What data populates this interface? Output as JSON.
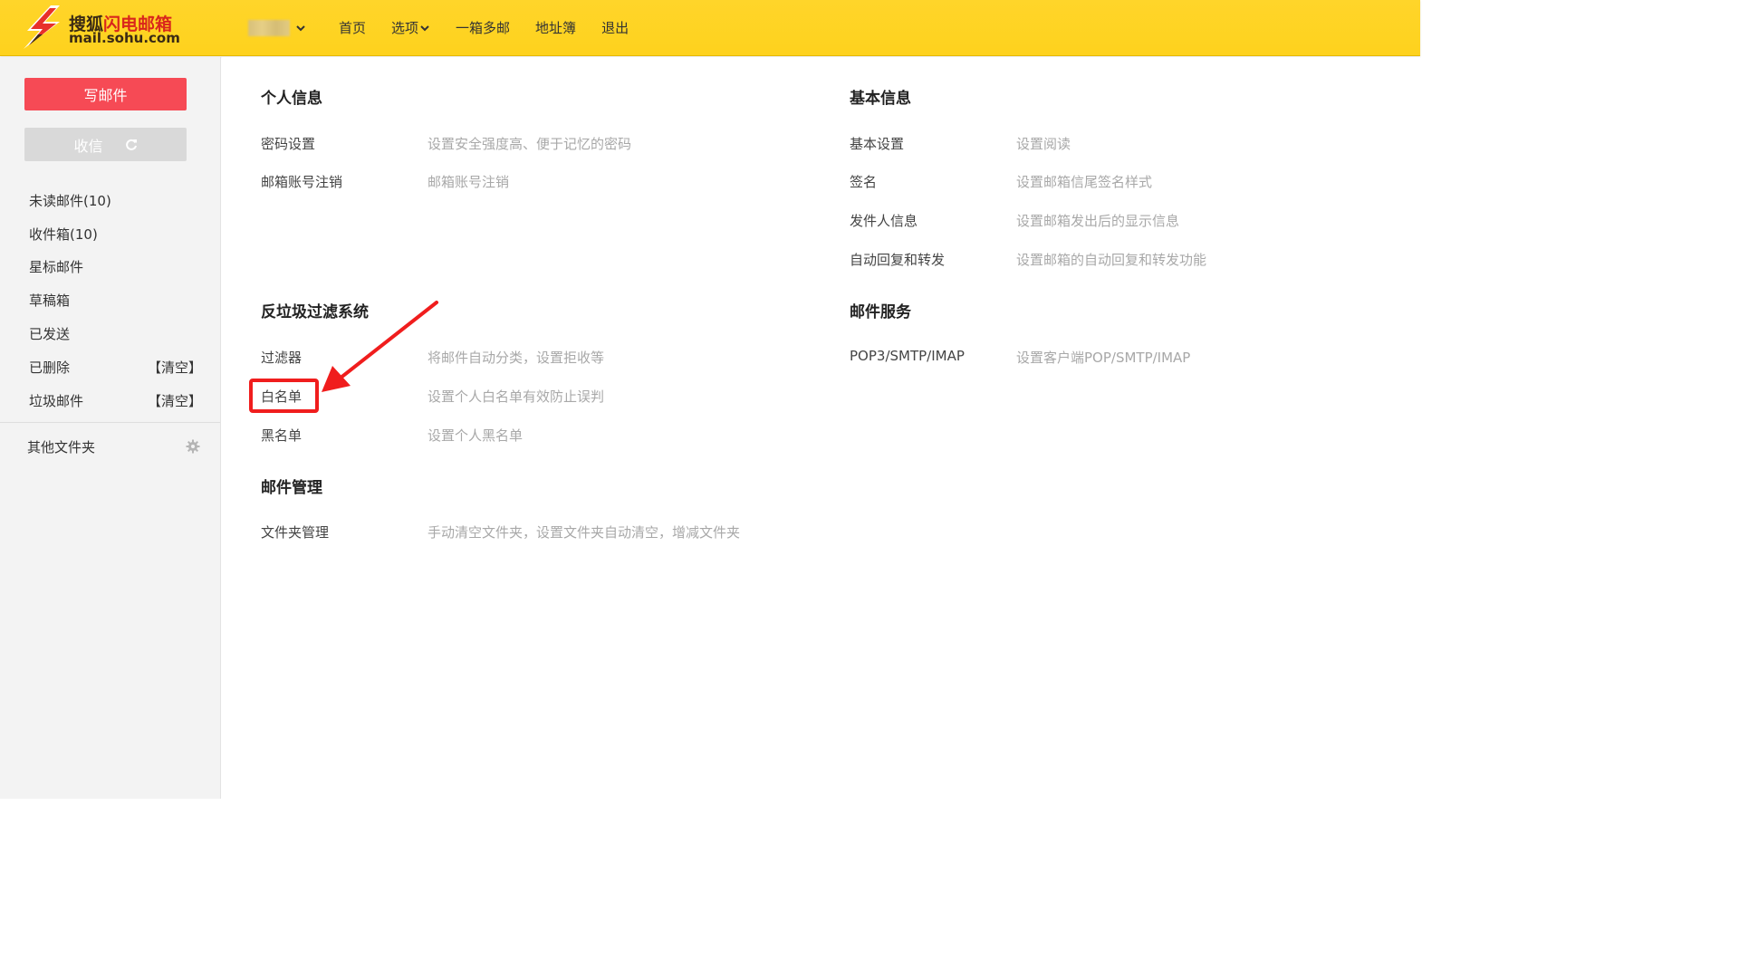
{
  "header": {
    "logo_title_part1": "搜狐",
    "logo_title_part2": "闪电邮箱",
    "logo_domain": "mail.sohu.com",
    "account_dropdown_icon": "chevron-down-icon",
    "nav": [
      {
        "label": "首页"
      },
      {
        "label": "选项",
        "has_dropdown": true
      },
      {
        "label": "一箱多邮"
      },
      {
        "label": "地址簿"
      },
      {
        "label": "退出"
      }
    ]
  },
  "sidebar": {
    "compose_label": "写邮件",
    "receive_label": "收信",
    "receive_icon": "refresh-icon",
    "folders": [
      {
        "label": "未读邮件(10)"
      },
      {
        "label": "收件箱(10)"
      },
      {
        "label": "星标邮件"
      },
      {
        "label": "草稿箱"
      },
      {
        "label": "已发送"
      },
      {
        "label": "已删除",
        "action": "【清空】"
      },
      {
        "label": "垃圾邮件",
        "action": "【清空】"
      }
    ],
    "other_folders_label": "其他文件夹",
    "other_folders_icon": "gear-icon"
  },
  "settings": {
    "personal": {
      "title": "个人信息",
      "rows": [
        {
          "label": "密码设置",
          "desc": "设置安全强度高、便于记忆的密码"
        },
        {
          "label": "邮箱账号注销",
          "desc": "邮箱账号注销"
        }
      ]
    },
    "antispam": {
      "title": "反垃圾过滤系统",
      "rows": [
        {
          "label": "过滤器",
          "desc": "将邮件自动分类，设置拒收等"
        },
        {
          "label": "白名单",
          "desc": "设置个人白名单有效防止误判"
        },
        {
          "label": "黑名单",
          "desc": "设置个人黑名单"
        }
      ]
    },
    "mail_management": {
      "title": "邮件管理",
      "rows": [
        {
          "label": "文件夹管理",
          "desc": "手动清空文件夹，设置文件夹自动清空，增减文件夹"
        }
      ]
    },
    "basic": {
      "title": "基本信息",
      "rows": [
        {
          "label": "基本设置",
          "desc": "设置阅读"
        },
        {
          "label": "签名",
          "desc": "设置邮箱信尾签名样式"
        },
        {
          "label": "发件人信息",
          "desc": "设置邮箱发出后的显示信息"
        },
        {
          "label": "自动回复和转发",
          "desc": "设置邮箱的自动回复和转发功能"
        }
      ]
    },
    "mail_service": {
      "title": "邮件服务",
      "rows": [
        {
          "label": "POP3/SMTP/IMAP",
          "desc": "设置客户端POP/SMTP/IMAP"
        }
      ]
    }
  },
  "annotation": {
    "color": "#f01d1d",
    "target": "白名单"
  },
  "colors": {
    "header_bg": "#fed21d",
    "compose_bg": "#f64a55",
    "receive_bg": "#d9d9d9",
    "sidebar_bg": "#f3f3f3"
  }
}
